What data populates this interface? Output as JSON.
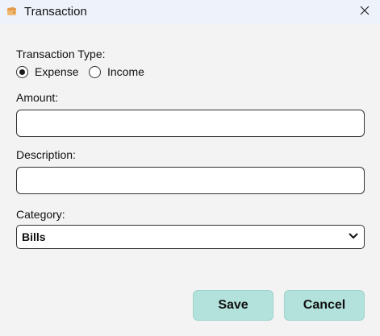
{
  "window": {
    "title": "Transaction",
    "icon": "wallet-icon",
    "close_icon": "close-icon"
  },
  "form": {
    "transaction_type_label": "Transaction Type:",
    "transaction_types": [
      {
        "label": "Expense",
        "selected": true
      },
      {
        "label": "Income",
        "selected": false
      }
    ],
    "amount_label": "Amount:",
    "amount_value": "",
    "description_label": "Description:",
    "description_value": "",
    "category_label": "Category:",
    "category_value": "Bills"
  },
  "buttons": {
    "save_label": "Save",
    "cancel_label": "Cancel"
  },
  "colors": {
    "button_bg": "#b3e2dc",
    "titlebar_bg": "#eef2fa",
    "window_bg": "#f3f3f3"
  }
}
